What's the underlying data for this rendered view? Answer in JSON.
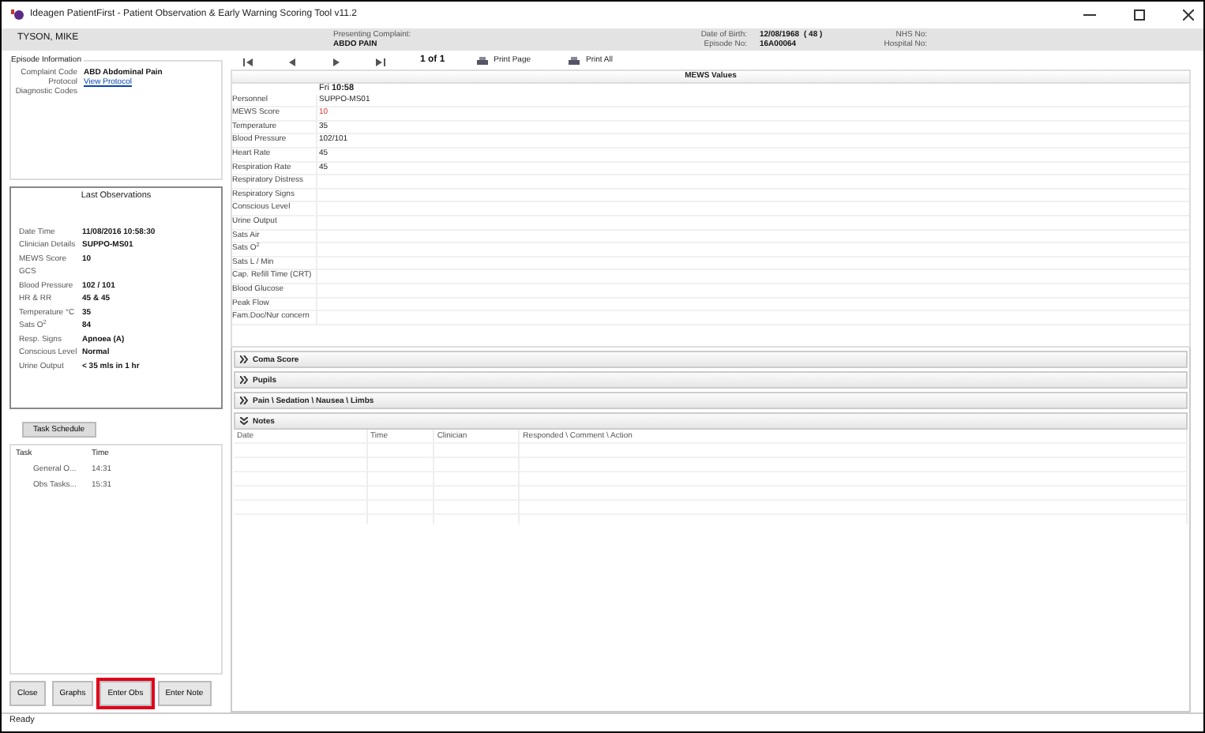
{
  "window": {
    "title": "Ideagen PatientFirst - Patient Observation & Early Warning Scoring Tool  v11.2"
  },
  "patient_header": {
    "name": "TYSON,  MIKE",
    "complaint_label": "Presenting Complaint:",
    "complaint_value": "ABDO PAIN",
    "dob_label": "Date of Birth:",
    "dob_value": "12/08/1968",
    "age": "( 48 )",
    "episode_label": "Episode No:",
    "episode_value": "16A00064",
    "nhs_label": "NHS No:",
    "hospital_label": "Hospital No:"
  },
  "episode_information": {
    "title": "Episode Information",
    "fields": [
      {
        "label": "Complaint Code",
        "value": "ABD Abdominal Pain",
        "kind": "text"
      },
      {
        "label": "Protocol",
        "value": "View Protocol",
        "kind": "link"
      },
      {
        "label": "Diagnostic Codes"
      }
    ]
  },
  "last_observations": {
    "title": "Last Observations",
    "rows": [
      {
        "label": "Date Time",
        "value": "11/08/2016 10:58:30"
      },
      {
        "label": "Clinician Details",
        "value": "SUPPO-MS01"
      },
      {
        "label": "MEWS Score",
        "value": "10"
      },
      {
        "label": "GCS"
      },
      {
        "label": "Blood Pressure",
        "value": "102 / 101"
      },
      {
        "label": "HR & RR",
        "value": "45 & 45"
      },
      {
        "label": "Temperature °C",
        "value": "35"
      },
      {
        "label": "Sats O$^{2}$",
        "value": "84"
      },
      {
        "label": "Resp. Signs",
        "value": "Apnoea (A)"
      },
      {
        "label": "Conscious Level",
        "value": "Normal"
      },
      {
        "label": "Urine Output",
        "value": "< 35 mls in 1 hr"
      }
    ]
  },
  "task_schedule": {
    "button": "Task Schedule",
    "columns": [
      "Task",
      "Time"
    ],
    "rows": [
      {
        "task": "General O...",
        "time": "14:31"
      },
      {
        "task": "Obs Tasks...",
        "time": "15:31"
      }
    ]
  },
  "buttons": [
    {
      "label": "Close",
      "highlighted": false
    },
    {
      "label": "Graphs",
      "highlighted": false
    },
    {
      "label": "Enter Obs",
      "highlighted": true
    },
    {
      "label": "Enter Note",
      "highlighted": false
    }
  ],
  "pager": {
    "page": "1 of 1",
    "actions": [
      "Print Page",
      "Print All"
    ]
  },
  "mews": {
    "title": "MEWS Values",
    "column": "Fri **10:58**",
    "rows": [
      {
        "label": "Personnel",
        "value": "SUPPO-MS01",
        "alert": false
      },
      {
        "label": "MEWS Score",
        "value": "10",
        "alert": true
      },
      {
        "label": "Temperature",
        "value": "35",
        "alert": false
      },
      {
        "label": "Blood Pressure",
        "value": "102/101",
        "alert": false
      },
      {
        "label": "Heart Rate",
        "value": "45",
        "alert": false
      },
      {
        "label": "Respiration Rate",
        "value": "45",
        "alert": false
      },
      {
        "label": "Respiratory Distress"
      },
      {
        "label": "Respiratory Signs"
      },
      {
        "label": "Conscious Level"
      },
      {
        "label": "Urine Output"
      },
      {
        "label": "Sats Air"
      },
      {
        "label": "Sats O$^{2}$"
      },
      {
        "label": "Sats L / Min"
      },
      {
        "label": "Cap. Refill Time (CRT)"
      },
      {
        "label": "Blood Glucose"
      },
      {
        "label": "Peak Flow"
      },
      {
        "label": "Fam.Doc/Nur concern"
      }
    ]
  },
  "sections": [
    {
      "label": "Coma Score",
      "expanded": false
    },
    {
      "label": "Pupils",
      "expanded": false
    },
    {
      "label": "Pain \\ Sedation \\ Nausea \\ Limbs",
      "expanded": false
    },
    {
      "label": "Notes",
      "expanded": true
    }
  ],
  "notes": {
    "columns": [
      "Date",
      "Time",
      "Clinician",
      "Responded  \\ Comment \\ Action"
    ]
  },
  "status_bar": "Ready"
}
